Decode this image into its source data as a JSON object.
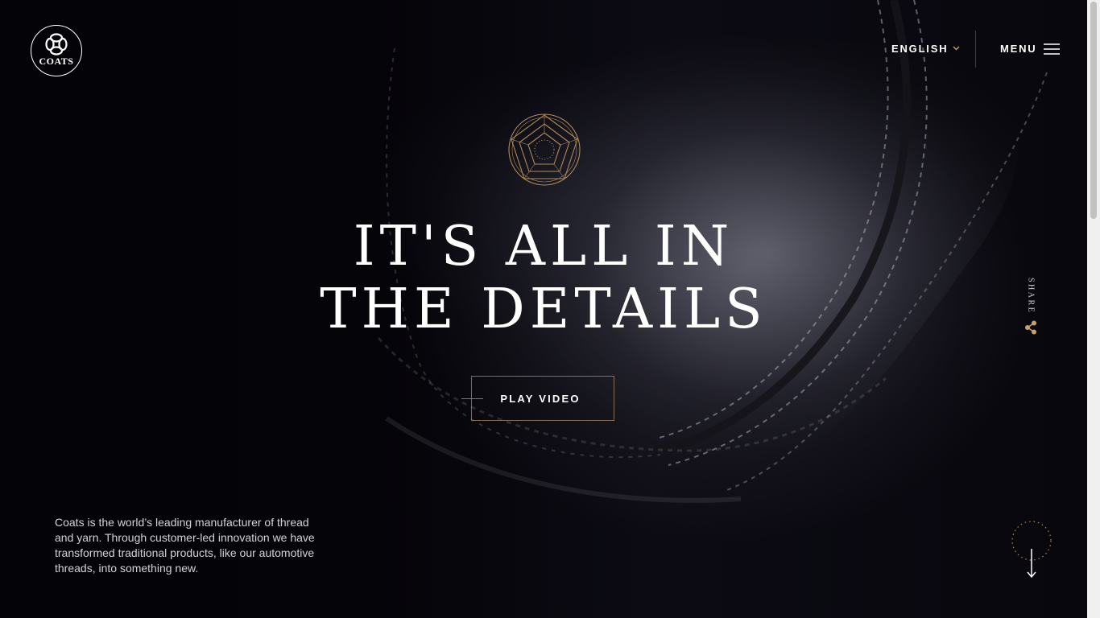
{
  "header": {
    "logo_text": "COATS",
    "language": "ENGLISH",
    "menu_label": "MENU"
  },
  "hero": {
    "headline_line1": "IT'S ALL IN",
    "headline_line2": "THE DETAILS",
    "play_video_label": "PLAY VIDEO",
    "share_label": "SHARE",
    "intro_text": "Coats is the world’s leading manufacturer of thread and yarn. Through customer-led innovation we have transformed traditional products, like our automotive threads, into something new."
  },
  "icons": {
    "logo": "coats-chain-logo-icon",
    "language_chevron": "chevron-down-icon",
    "menu": "hamburger-menu-icon",
    "emblem": "pentagon-emblem-icon",
    "share": "share-icon",
    "scroll": "arrow-down-icon"
  },
  "colors": {
    "background": "#040309",
    "accent_gold": "#b08a5a",
    "text": "#ffffff"
  }
}
